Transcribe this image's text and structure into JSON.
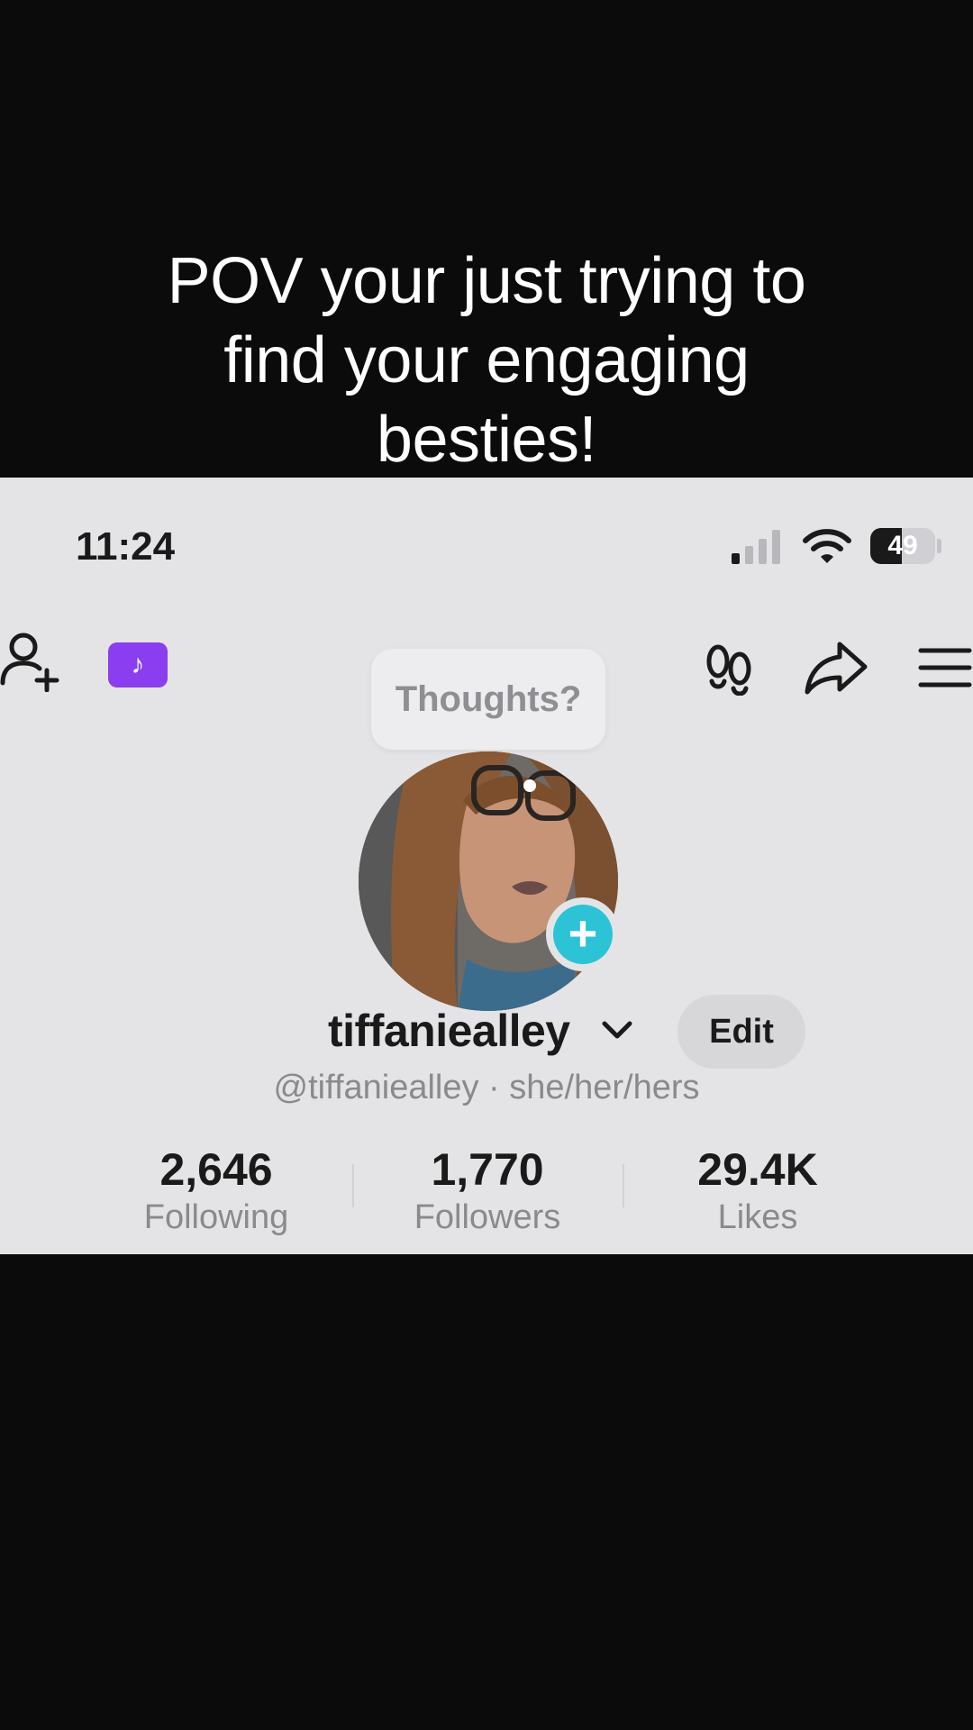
{
  "caption": {
    "line1": "POV your just trying to",
    "line2": "find your engaging",
    "line3": "besties!"
  },
  "status_bar": {
    "time": "11:24",
    "battery_level": "49",
    "battery_fraction": 0.49,
    "signal_bars_active": 1,
    "signal_bars_total": 4
  },
  "header": {
    "icons": [
      "add-friend-icon",
      "tiktok-badge-icon",
      "footprint-icon",
      "share-icon",
      "menu-icon"
    ],
    "badge_color": "#8a3ef0"
  },
  "tooltip": {
    "text": "Thoughts?"
  },
  "profile": {
    "username": "tiffaniealley",
    "handle_line": "@tiffaniealley · she/her/hers",
    "edit_label": "Edit",
    "add_icon_color": "#2bc3d5",
    "add_icon_glyph": "+"
  },
  "stats": [
    {
      "value": "2,646",
      "label": "Following"
    },
    {
      "value": "1,770",
      "label": "Followers"
    },
    {
      "value": "29.4K",
      "label": "Likes"
    }
  ]
}
